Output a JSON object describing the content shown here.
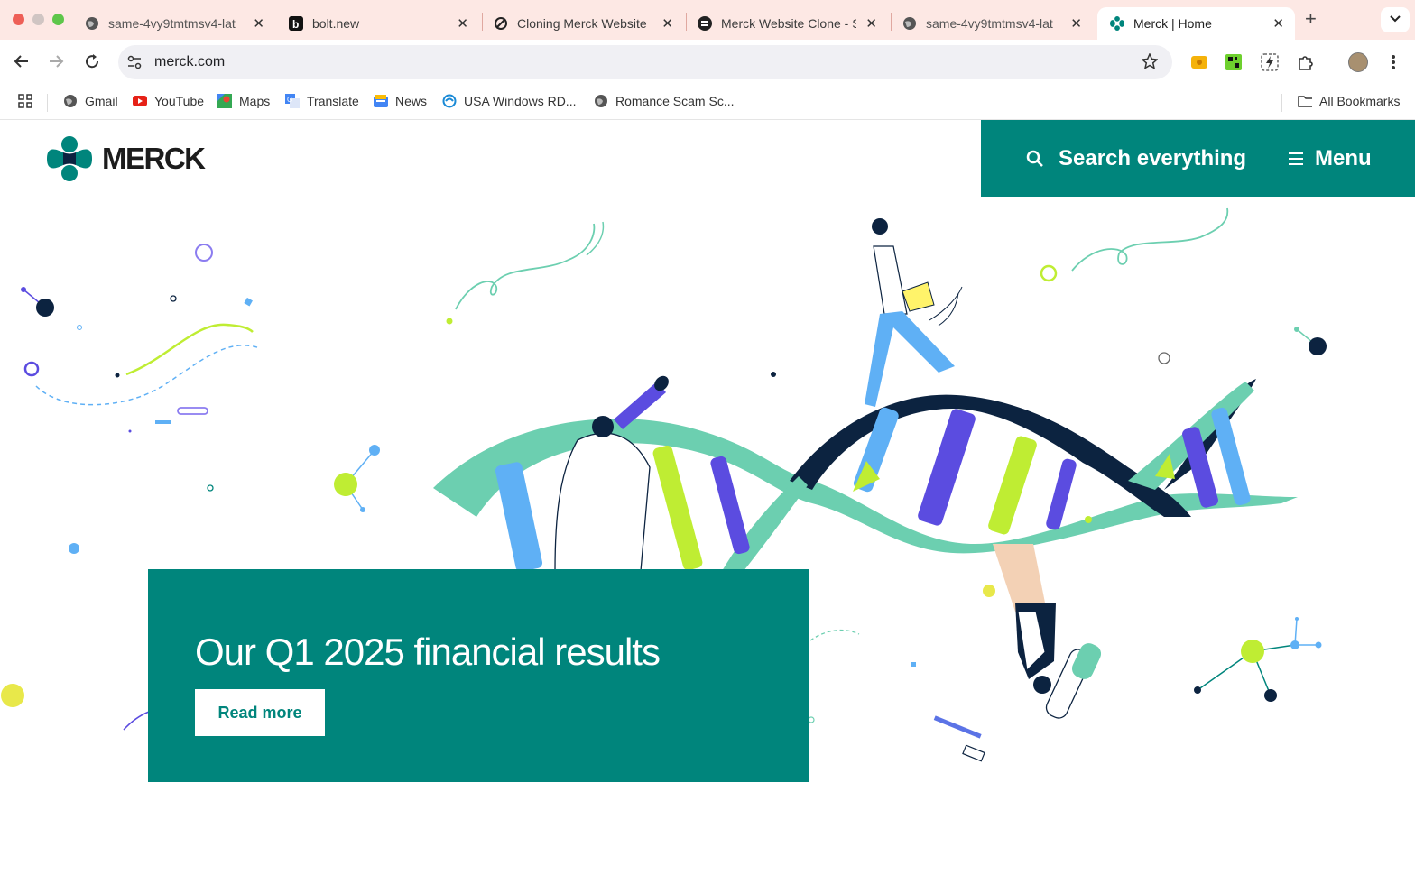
{
  "browser": {
    "tabs": [
      {
        "title": "same-4vy9tmtmsv4-lat",
        "icon": "globe-icon",
        "active": false
      },
      {
        "title": "bolt.new",
        "icon": "bolt-icon",
        "active": false
      },
      {
        "title": "Cloning Merck Website",
        "icon": "cursor-icon",
        "active": false
      },
      {
        "title": "Merck Website Clone - S",
        "icon": "same-icon",
        "active": false
      },
      {
        "title": "same-4vy9tmtmsv4-lat",
        "icon": "globe-icon",
        "active": false
      },
      {
        "title": "Merck | Home",
        "icon": "merck-icon",
        "active": true
      }
    ],
    "new_tab": "+",
    "address": "merck.com",
    "bookmarks": [
      {
        "label": "Gmail",
        "icon": "globe-icon"
      },
      {
        "label": "YouTube",
        "icon": "youtube-icon"
      },
      {
        "label": "Maps",
        "icon": "maps-icon"
      },
      {
        "label": "Translate",
        "icon": "translate-icon"
      },
      {
        "label": "News",
        "icon": "news-icon"
      },
      {
        "label": "USA Windows RD...",
        "icon": "rdp-icon"
      },
      {
        "label": "Romance Scam Sc...",
        "icon": "globe-icon"
      }
    ],
    "all_bookmarks": "All Bookmarks"
  },
  "site": {
    "logo_text": "MERCK",
    "search_label": "Search everything",
    "menu_label": "Menu",
    "hero": {
      "title": "Our Q1 2025 financial results",
      "cta": "Read more"
    },
    "colors": {
      "brand": "#00857c",
      "navy": "#0c2340",
      "lime": "#bfed33",
      "blue": "#5fb0f5",
      "violet": "#5b4ce0",
      "mint": "#6ccfb0"
    }
  }
}
